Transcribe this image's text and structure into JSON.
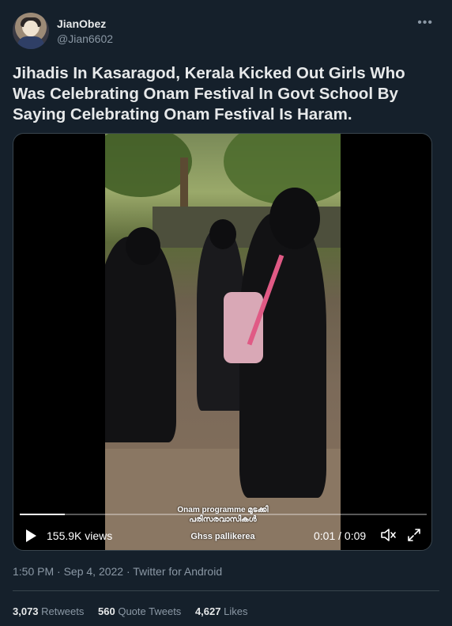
{
  "author": {
    "name": "JianObez",
    "handle": "@Jian6602",
    "more_icon": "more-horizontal-icon"
  },
  "tweet": {
    "text": "Jihadis In Kasaragod, Kerala Kicked Out Girls Who Was Celebrating Onam Festival In Govt School By Saying Celebrating Onam Festival Is Haram."
  },
  "video": {
    "caption_line1": "Onam programme മുടക്കി",
    "caption_line2": "പരിസരവാസികൾ",
    "caption_line3": "Ghss pallikerea",
    "views": "155.9K views",
    "time": "0:01 / 0:09",
    "progress_fraction": 0.11,
    "play_icon": "play-icon",
    "volume_icon": "volume-icon",
    "fullscreen_icon": "fullscreen-icon"
  },
  "meta": {
    "timestamp": "1:50 PM · Sep 4, 2022 · Twitter for Android"
  },
  "stats": {
    "retweets_count": "3,073",
    "retweets_label": "Retweets",
    "quotes_count": "560",
    "quotes_label": "Quote Tweets",
    "likes_count": "4,627",
    "likes_label": "Likes"
  },
  "colors": {
    "background": "#15202b",
    "text": "#e7e9ea",
    "muted": "#8b98a5",
    "border": "#38444d"
  }
}
